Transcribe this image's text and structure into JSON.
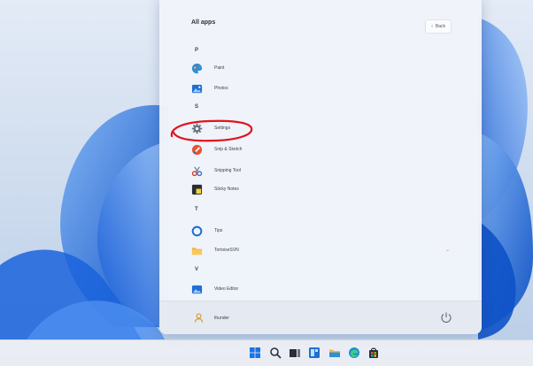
{
  "start_menu": {
    "title": "All apps",
    "back_label": "Back",
    "sections": [
      {
        "letter": "P",
        "apps": [
          {
            "label": "Paint",
            "icon": "paint-icon"
          },
          {
            "label": "Photos",
            "icon": "photos-icon"
          }
        ]
      },
      {
        "letter": "S",
        "apps": [
          {
            "label": "Settings",
            "icon": "settings-gear-icon"
          },
          {
            "label": "Snip & Sketch",
            "icon": "snip-sketch-icon"
          },
          {
            "label": "Snipping Tool",
            "icon": "snipping-tool-icon"
          },
          {
            "label": "Sticky Notes",
            "icon": "sticky-notes-icon"
          }
        ]
      },
      {
        "letter": "T",
        "apps": [
          {
            "label": "Tips",
            "icon": "tips-icon"
          },
          {
            "label": "TortoiseSVN",
            "icon": "folder-icon",
            "expandable": true
          }
        ]
      },
      {
        "letter": "V",
        "apps": [
          {
            "label": "Video Editor",
            "icon": "video-editor-icon"
          }
        ]
      }
    ],
    "user_name": "thunder",
    "highlighted_app": "Settings",
    "highlight_color": "#e0141e"
  },
  "taskbar": {
    "icons": [
      "windows-start-icon",
      "search-icon",
      "task-view-icon",
      "widgets-icon",
      "file-explorer-icon",
      "edge-icon",
      "store-icon"
    ]
  },
  "colors": {
    "accent": "#0a5fd8",
    "wallpaper_blue": "#1e6fe0"
  }
}
